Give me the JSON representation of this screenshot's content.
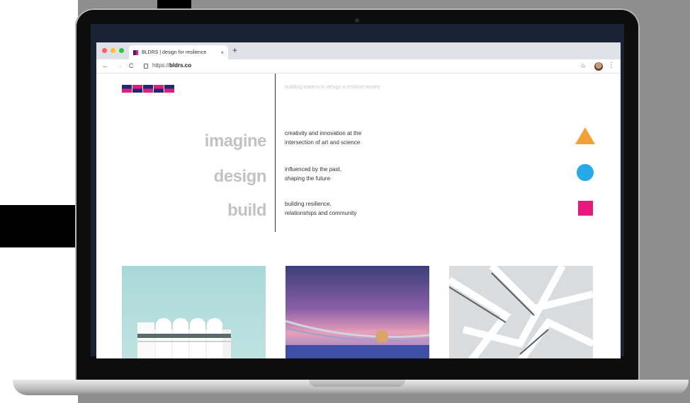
{
  "browser": {
    "tab_title": "BLDRS | design for resilience",
    "tab_close": "×",
    "new_tab": "+",
    "nav_back": "←",
    "nav_forward": "→",
    "nav_reload": "C",
    "url_prefix": "https://",
    "url_domain": "bldrs.co",
    "bookmark_icon": "☆",
    "menu_icon": "⋮"
  },
  "page": {
    "logo_text": "BLDRS",
    "tagline": "building leaders to design a resilient society",
    "rows": [
      {
        "word": "imagine",
        "desc_line1": "creativity and innovation at the",
        "desc_line2": "intersection of art and science",
        "shape": "triangle",
        "color": "#f4a03a"
      },
      {
        "word": "design",
        "desc_line1": "influenced by the past,",
        "desc_line2": "shaping the future",
        "shape": "circle",
        "color": "#27a9e8"
      },
      {
        "word": "build",
        "desc_line1": "building resilience,",
        "desc_line2": "relationships and community",
        "shape": "square",
        "color": "#e6197d"
      }
    ],
    "photos": [
      "building-photo",
      "bridge-sunset-photo",
      "lattice-architecture-photo"
    ]
  },
  "colors": {
    "brand_navy": "#1e2a78",
    "brand_pink": "#e6197d",
    "accent_orange": "#f4a03a",
    "accent_blue": "#27a9e8"
  }
}
